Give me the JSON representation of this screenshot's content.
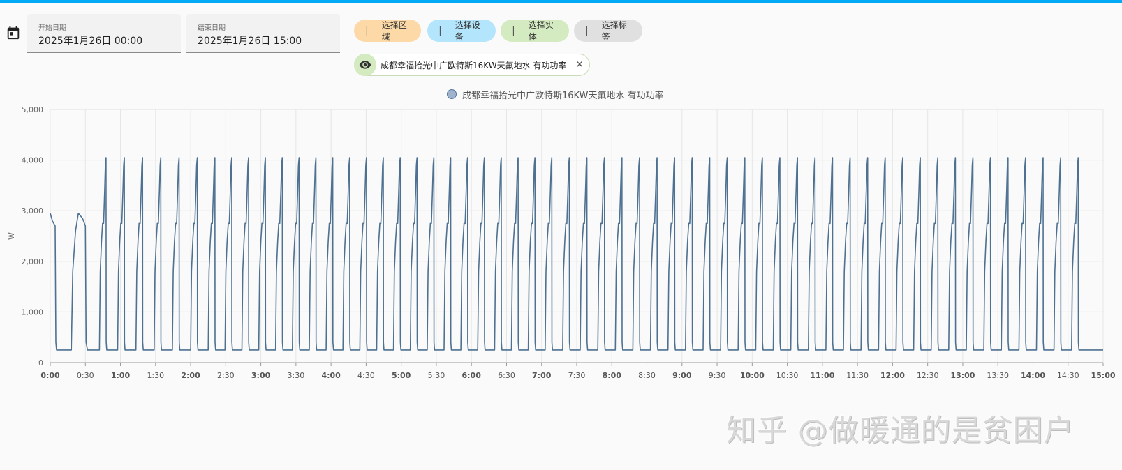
{
  "filters": {
    "start_label": "开始日期",
    "start_value": "2025年1月26日 00:00",
    "end_label": "结束日期",
    "end_value": "2025年1月26日 15:00"
  },
  "targets": {
    "area": "选择区域",
    "device": "选择设备",
    "entity": "选择实体",
    "label": "选择标签"
  },
  "selected_entity": "成都幸福拾光中广欧特斯16KW天氟地水 有功功率",
  "icons": {
    "calendar": "calendar-icon",
    "plus": "plus-icon",
    "eye": "eye-icon",
    "close": "close-icon"
  },
  "colors": {
    "accent": "#03a9f4",
    "series": "#4e7191",
    "area_chip": "#fcd9a6",
    "device_chip": "#b3e5fc",
    "entity_chip": "#d4ebc1",
    "label_chip": "#e0e0e0"
  },
  "watermark": "知乎 @做暖通的是贫困户",
  "chart_data": {
    "type": "line",
    "title": "",
    "xlabel": "",
    "ylabel": "W",
    "ylim": [
      0,
      5000
    ],
    "xlim_hours": [
      0,
      15
    ],
    "yticks": [
      0,
      1000,
      2000,
      3000,
      4000,
      5000
    ],
    "ytick_labels": [
      "0",
      "1,000",
      "2,000",
      "3,000",
      "4,000",
      "5,000"
    ],
    "xtick_labels": [
      "0:00",
      "0:30",
      "1:00",
      "1:30",
      "2:00",
      "2:30",
      "3:00",
      "3:30",
      "4:00",
      "4:30",
      "5:00",
      "5:30",
      "6:00",
      "6:30",
      "7:00",
      "7:30",
      "8:00",
      "8:30",
      "9:00",
      "9:30",
      "10:00",
      "10:30",
      "11:00",
      "11:30",
      "12:00",
      "12:30",
      "13:00",
      "13:30",
      "14:00",
      "14:30",
      "15:00"
    ],
    "grid": true,
    "legend_position": "top-center",
    "series": [
      {
        "name": "成都幸福拾光中广欧特斯16KW天氟地水 有功功率",
        "color": "#4e7191",
        "baseline_w": 250,
        "cycle_peak_w": 4050,
        "cycle_plateau_w": 2750,
        "cycle_start_hours": [
          0.7,
          0.96,
          1.22,
          1.48,
          1.74,
          2.0,
          2.25,
          2.49,
          2.73,
          2.97,
          3.21,
          3.45,
          3.69,
          3.93,
          4.17,
          4.41,
          4.65,
          4.89,
          5.13,
          5.37,
          5.61,
          5.85,
          6.09,
          6.33,
          6.57,
          6.81,
          7.05,
          7.3,
          7.55,
          7.8,
          8.05,
          8.3,
          8.55,
          8.8,
          9.05,
          9.3,
          9.55,
          9.8,
          10.05,
          10.3,
          10.55,
          10.8,
          11.05,
          11.3,
          11.55,
          11.8,
          12.05,
          12.3,
          12.55,
          12.8,
          13.05,
          13.3,
          13.55,
          13.8,
          14.05,
          14.3,
          14.55
        ],
        "initial_segment": [
          [
            0,
            2950
          ],
          [
            0.03,
            2800
          ],
          [
            0.07,
            2700
          ],
          [
            0.08,
            400
          ],
          [
            0.09,
            250
          ],
          [
            0.3,
            250
          ],
          [
            0.32,
            1800
          ],
          [
            0.36,
            2600
          ],
          [
            0.4,
            2950
          ],
          [
            0.46,
            2850
          ],
          [
            0.5,
            2700
          ],
          [
            0.51,
            400
          ],
          [
            0.53,
            250
          ],
          [
            0.7,
            250
          ]
        ],
        "end_value_w": 250
      }
    ]
  }
}
